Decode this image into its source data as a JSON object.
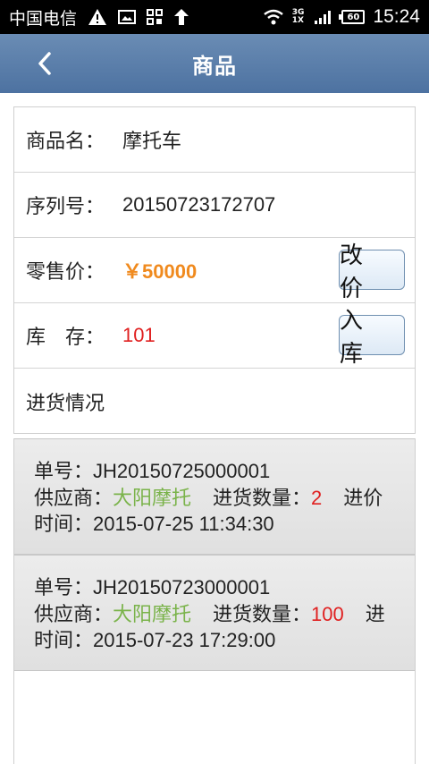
{
  "status_bar": {
    "carrier": "中国电信",
    "network_badge_top": "3G",
    "network_badge_bottom": "1X",
    "battery": "60",
    "time": "15:24"
  },
  "header": {
    "title": "商品"
  },
  "product": {
    "name_label": "商品名：",
    "name_value": "摩托车",
    "serial_label": "序列号：",
    "serial_value": "20150723172707",
    "price_label": "零售价：",
    "price_value": "￥50000",
    "price_button": "改 价",
    "stock_label": "库　存：",
    "stock_value": "101",
    "stock_button": "入 库",
    "purchase_section": "进货情况"
  },
  "purchases": [
    {
      "order_label": "单号：",
      "order_no": "JH20150725000001",
      "supplier_label": "供应商：",
      "supplier": "大阳摩托",
      "qty_label": "进货数量：",
      "qty": "2",
      "trailing": "进价",
      "time_label": "时间：",
      "time": "2015-07-25 11:34:30"
    },
    {
      "order_label": "单号：",
      "order_no": "JH20150723000001",
      "supplier_label": "供应商：",
      "supplier": "大阳摩托",
      "qty_label": "进货数量：",
      "qty": "100",
      "trailing": "进",
      "time_label": "时间：",
      "time": "2015-07-23 17:29:00"
    }
  ]
}
